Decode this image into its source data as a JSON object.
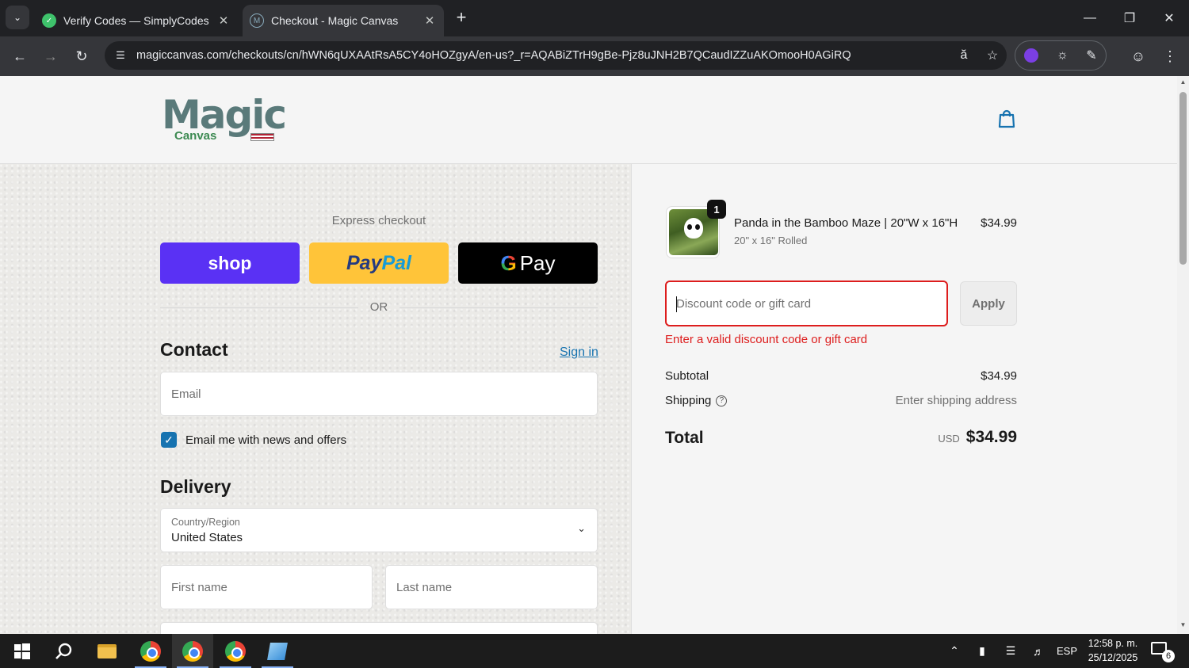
{
  "browser": {
    "tabs": [
      {
        "title": "Verify Codes — SimplyCodes",
        "favicon": "simplycodes-icon",
        "active": false
      },
      {
        "title": "Checkout - Magic Canvas",
        "favicon": "magic-canvas-icon",
        "active": true
      }
    ],
    "url": "magiccanvas.com/checkouts/cn/hWN6qUXAAtRsA5CY4oHOZgyA/en-us?_r=AQABiZTrH9gBe-Pjz8uJNH2B7QCaudIZZuAKOmooH0AGiRQ"
  },
  "header": {
    "logo_text": "Magic",
    "logo_subtext": "Canvas",
    "logo_flag": "USA"
  },
  "express": {
    "label": "Express checkout",
    "shop_label": "shop",
    "paypal_label_1": "Pay",
    "paypal_label_2": "Pal",
    "gpay_g": "G",
    "gpay_label": "Pay",
    "or_label": "OR"
  },
  "contact": {
    "heading": "Contact",
    "signin_label": "Sign in",
    "email_placeholder": "Email",
    "newsletter_label": "Email me with news and offers",
    "newsletter_checked": true
  },
  "delivery": {
    "heading": "Delivery",
    "country_label": "Country/Region",
    "country_value": "United States",
    "first_name_placeholder": "First name",
    "last_name_placeholder": "Last name"
  },
  "summary": {
    "product": {
      "name": "Panda in the Bamboo Maze | 20\"W x 16\"H",
      "variant": "20\" x 16\" Rolled",
      "price": "$34.99",
      "quantity": "1"
    },
    "discount_placeholder": "Discount code or gift card",
    "apply_label": "Apply",
    "error": "Enter a valid discount code or gift card",
    "subtotal_label": "Subtotal",
    "subtotal_value": "$34.99",
    "shipping_label": "Shipping",
    "shipping_value": "Enter shipping address",
    "total_label": "Total",
    "total_currency": "USD",
    "total_value": "$34.99"
  },
  "taskbar": {
    "language": "ESP",
    "time": "12:58 p. m.",
    "date": "25/12/2025",
    "notifications": "6"
  },
  "colors": {
    "shop": "#5a31f4",
    "paypal": "#ffc439",
    "link": "#1773b0",
    "error": "#dd1d1d"
  }
}
